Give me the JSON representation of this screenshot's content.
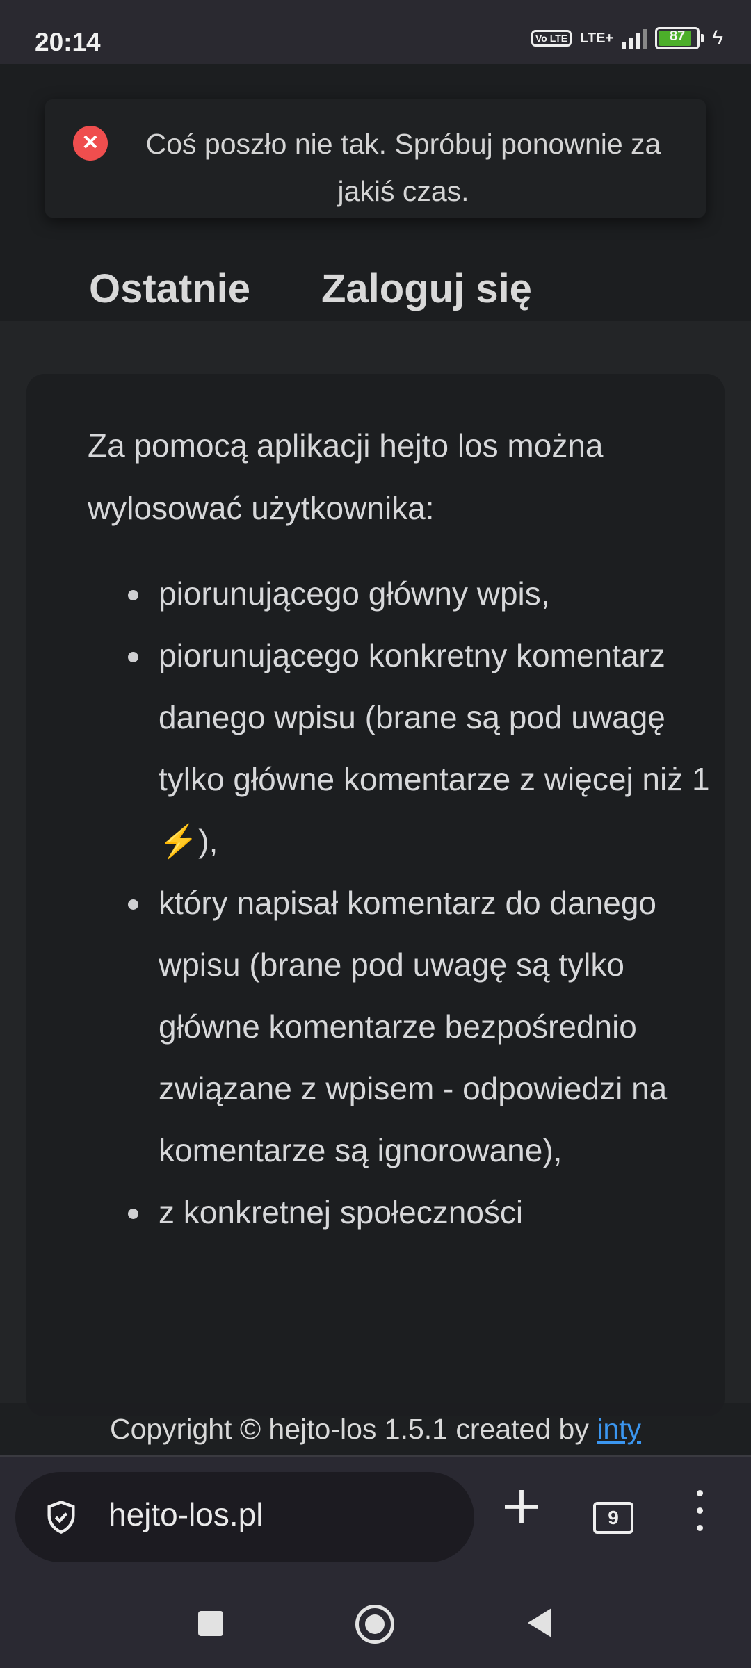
{
  "status_bar": {
    "time": "20:14",
    "volte_label": "Vo LTE",
    "network_label": "LTE+",
    "battery_level": "87",
    "icons": [
      "volte-icon",
      "signal-icon",
      "battery-icon",
      "charging-icon"
    ]
  },
  "header": {
    "link_1": "Ostatnie",
    "link_2": "Zaloguj się"
  },
  "toast": {
    "icon": "error-icon",
    "message": "Coś poszło nie tak. Spróbuj ponownie za jakiś czas."
  },
  "content": {
    "intro": "Za pomocą aplikacji hejto los można wylosować użytkownika:",
    "items": [
      "piorunującego główny wpis,",
      "piorunującego konkretny komentarz danego wpisu (brane są pod uwagę tylko główne komentarze z więcej niż 1 ⚡),",
      "który napisał komentarz do danego wpisu (brane pod uwagę są tylko główne komentarze bezpośrednio związane z wpisem - odpowiedzi na komentarze są ignorowane),",
      "z konkretnej społeczności"
    ]
  },
  "footer": {
    "text": "Copyright © hejto-los 1.5.1 created by ",
    "link": "inty"
  },
  "browser": {
    "url": "hejto-los.pl",
    "tab_count": "9",
    "icons": [
      "shield-icon",
      "plus-icon",
      "tabs-icon",
      "more-icon"
    ]
  },
  "navigation": {
    "icons": [
      "recents-icon",
      "home-icon",
      "back-icon"
    ]
  }
}
